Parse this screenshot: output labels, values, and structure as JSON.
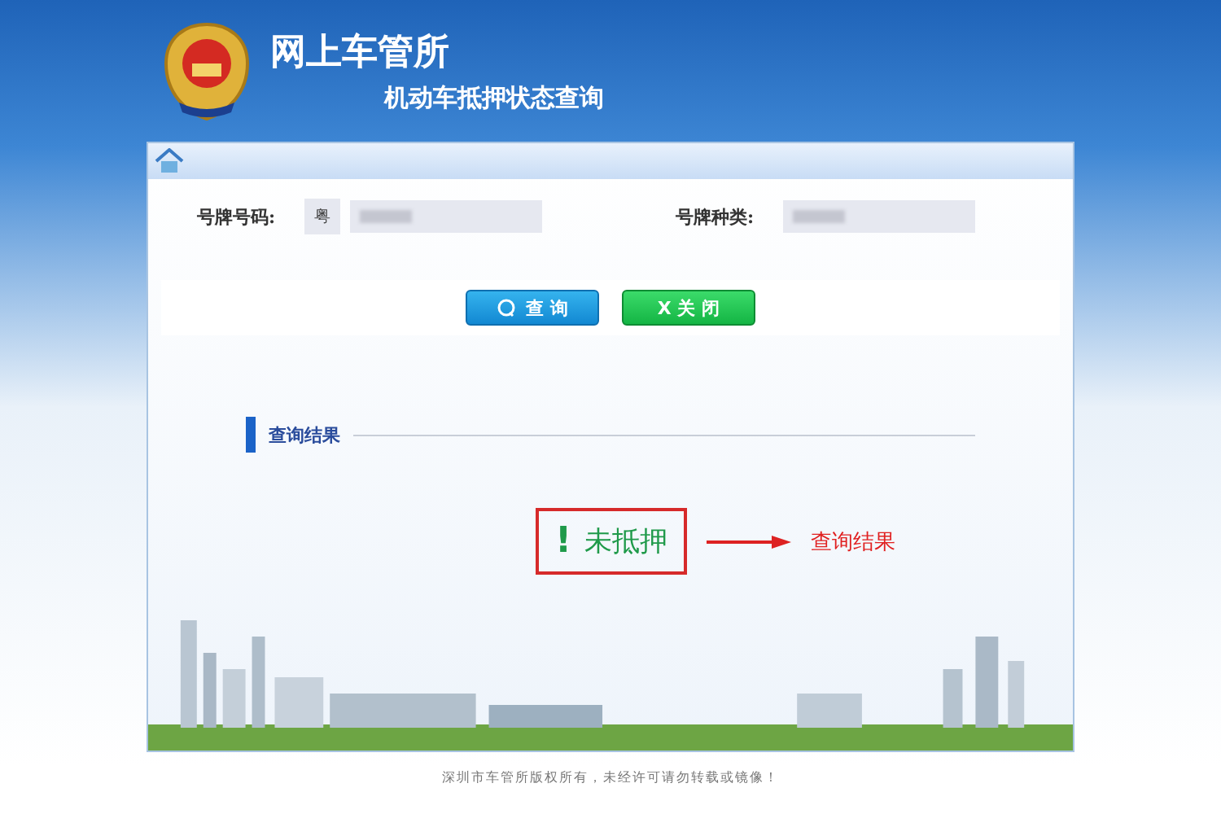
{
  "header": {
    "title": "网上车管所",
    "subtitle": "机动车抵押状态查询"
  },
  "form": {
    "fields": [
      {
        "label": "号牌号码:",
        "prefix": "粤"
      },
      {
        "label": "号牌种类:"
      }
    ]
  },
  "buttons": [
    {
      "label": "查 询",
      "kind": "search"
    },
    {
      "label": "X 关 闭",
      "kind": "close"
    }
  ],
  "result": {
    "section_title": "查询结果",
    "mark": "!",
    "status": "未抵押",
    "annotation": "查询结果"
  },
  "footer": "深圳市车管所版权所有，未经许可请勿转载或镜像！"
}
